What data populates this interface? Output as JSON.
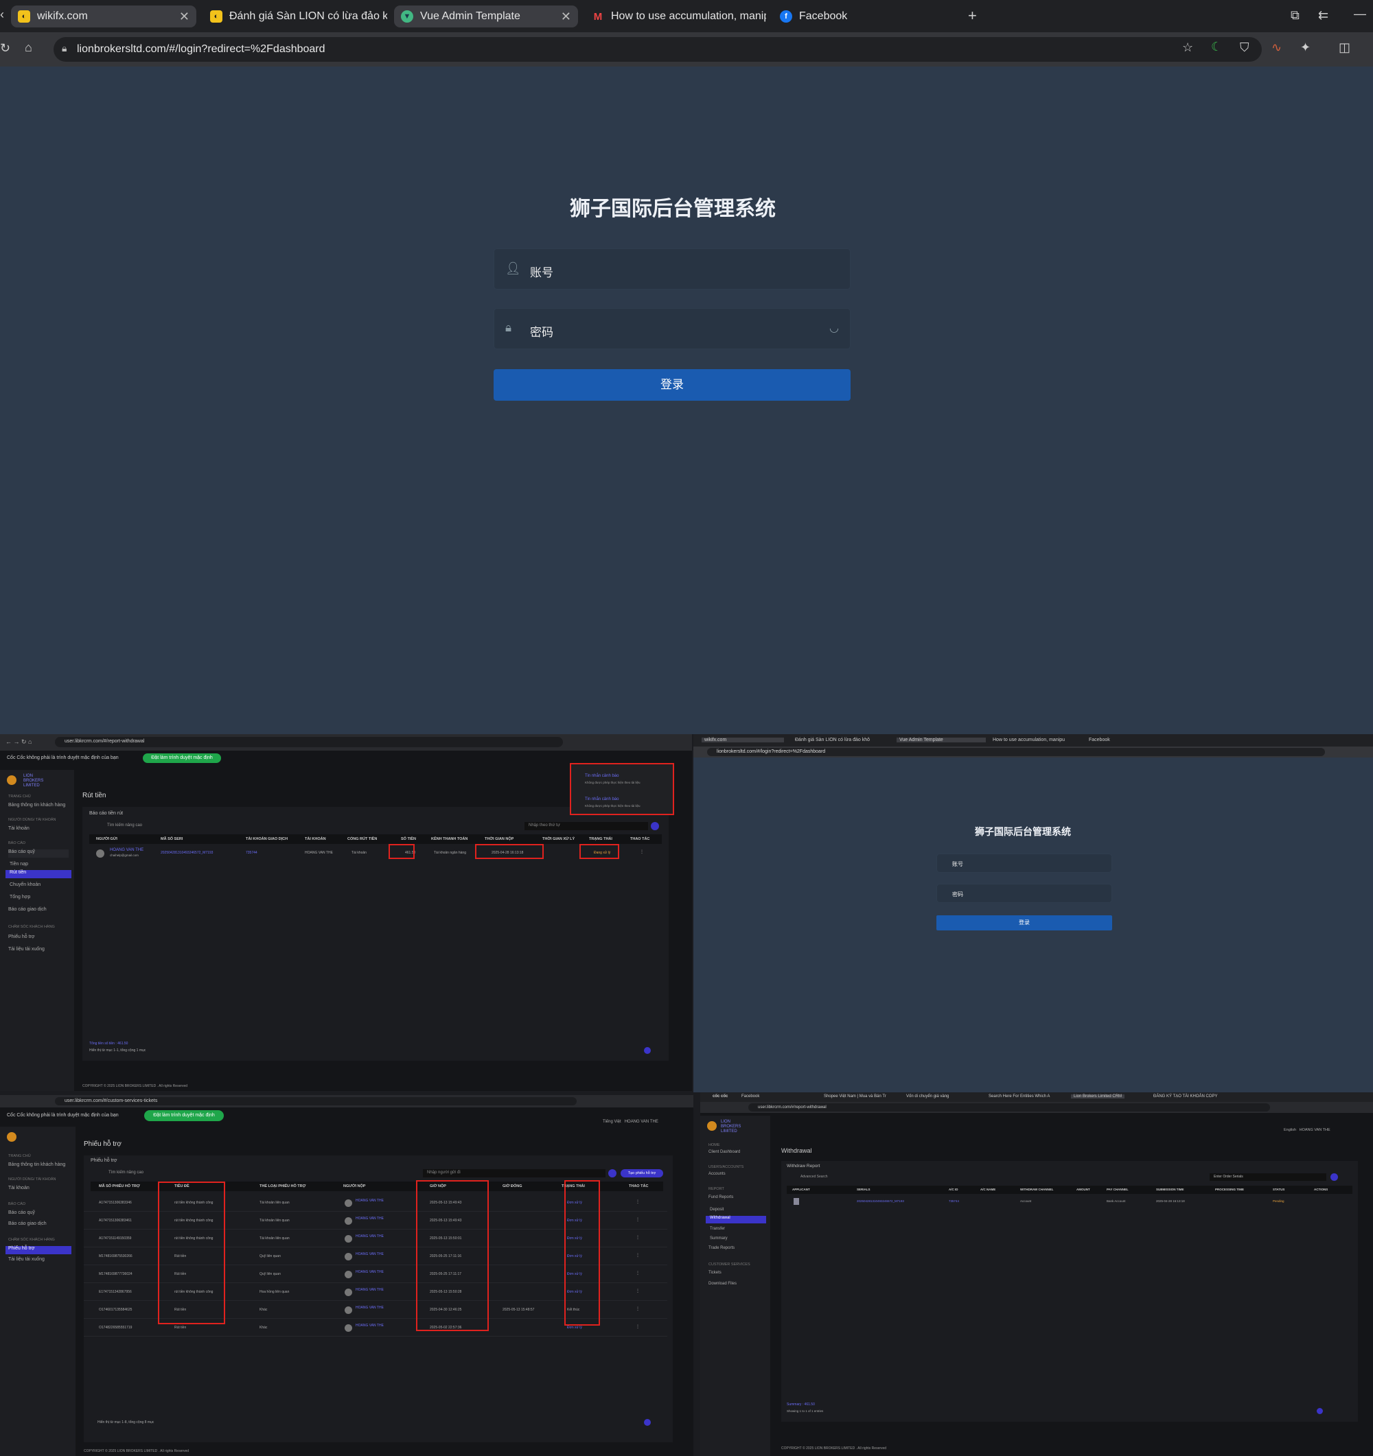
{
  "browser": {
    "tabs": [
      {
        "label": "wikifx.com",
        "active": false
      },
      {
        "label": "Đánh giá Sàn LION có lừa đảo khô",
        "active": false
      },
      {
        "label": "Vue Admin Template",
        "active": true
      },
      {
        "label": "How to use accumulation, manipu",
        "active": false
      },
      {
        "label": "Facebook",
        "active": false
      }
    ],
    "url": "lionbrokersltd.com/#/login?redirect=%2Fdashboard"
  },
  "login": {
    "title": "狮子国际后台管理系统",
    "username_placeholder": "账号",
    "password_placeholder": "密码",
    "submit_label": "登录"
  },
  "panel_withdraw": {
    "url": "user.libkrcrm.com/#/report-withdrawal",
    "notice": "Cốc Cốc không phải là trình duyệt mặc định của bạn",
    "notice_btn": "Đặt làm trình duyệt mặc định",
    "brand": "LION BROKERS LIMITED",
    "sidebar": {
      "h1": "TRANG CHỦ",
      "i1": "Bảng thông tin khách hàng",
      "h2": "NGƯỜI DÙNG/ TÀI KHOẢN",
      "i2": "Tài khoản",
      "h3": "BÁO CÁO",
      "i3": "Báo cáo quỹ",
      "i4": "Tiền nạp",
      "i5": "Rút tiền",
      "i6": "Chuyển khoản",
      "i7": "Tổng hợp",
      "i8": "Báo cáo giao dịch",
      "h4": "CHĂM SÓC KHÁCH HÀNG",
      "i9": "Phiếu hỗ trợ",
      "i10": "Tải liệu tải xuống"
    },
    "page_title": "Rút tiền",
    "section": "Báo cáo tiền rút",
    "advanced": "Tìm kiếm nâng cao",
    "search_placeholder": "Nhập theo thứ tự",
    "headers": [
      "NGƯỜI GỬI",
      "MÃ SỐ SERI",
      "TÀI KHOẢN GIAO DỊCH",
      "TÀI KHOẢN",
      "CỔNG RÚT TIỀN",
      "SỐ TIỀN",
      "KÊNH THANH TOÁN",
      "THỜI GIAN NỘP",
      "THỜI GIAN XỬ LÝ",
      "TRẠNG THÁI",
      "THAO TÁC"
    ],
    "row": {
      "name": "HOANG VAN THE",
      "email": "chaihelp@gmail.com",
      "serial": "202504281310493246572_M7193",
      "account_no": "735744",
      "holder": "HOANG VAN THE",
      "gateway": "Tài khoản",
      "amount": "461.50",
      "channel": "Tài khoản ngân hàng",
      "submitted": "2025-04-28 16:13:18",
      "status": "Đang xử lý"
    },
    "total": "Tổng tiền số tiền : 461.50",
    "showing": "Hiển thị từ mục 1-1, tổng cộng 1 mục",
    "toast_title": "Tin nhắn cảnh báo",
    "toast_body": "Không được phép thực hiện theo tài liệu",
    "footer": "COPYRIGHT © 2025 LION BROKERS LIMITED . All rights Reserved"
  },
  "panel_login_small": {
    "tabs": [
      "wikifx.com",
      "Đánh giá Sàn LION có lừa đảo khô",
      "Vue Admin Template",
      "How to use accumulation, manipu",
      "Facebook"
    ],
    "url": "lionbrokersltd.com/#/login?redirect=%2Fdashboard",
    "title": "狮子国际后台管理系统",
    "username": "账号",
    "password": "密码",
    "submit": "登录"
  },
  "panel_tickets": {
    "url": "user.libkrcrm.com/#/custom-services-tickets",
    "page_title": "Phiếu hỗ trợ",
    "section": "Phiếu hỗ trợ",
    "search_placeholder": "Nhập người gửi đi",
    "create_btn": "Tạo phiếu hỗ trợ",
    "user_lang": "Tiếng Việt",
    "user_name": "HOANG VAN THE",
    "headers": [
      "MÃ SỐ PHIẾU HỖ TRỢ",
      "TIÊU ĐỀ",
      "THỂ LOẠI PHIẾU HỖ TRỢ",
      "NGƯỜI NỘP",
      "GIỜ NỘP",
      "GIỜ ĐÓNG",
      "TRẠNG THÁI",
      "THAO TÁC"
    ],
    "rows": [
      {
        "id": "A1747151306383346",
        "title": "rút tiền không thành công",
        "type": "Tài khoản liên quan",
        "time": "2025-05-13 15:49:43",
        "close": "",
        "status": "Đơn xử lý"
      },
      {
        "id": "A1747151306383461",
        "title": "rút tiền không thành công",
        "type": "Tài khoản liên quan",
        "time": "2025-05-13 15:49:43",
        "close": "",
        "status": "Đơn xử lý"
      },
      {
        "id": "A1747151149150359",
        "title": "rút tiền không thành công",
        "type": "Tài khoản liên quan",
        "time": "2025-05-13 15:50:01",
        "close": "",
        "status": "Đơn xử lý"
      },
      {
        "id": "M1748169875530266",
        "title": "Rút tiền",
        "type": "Quỹ liên quan",
        "time": "2025-05-25 17:11:16",
        "close": "",
        "status": "Đơn xử lý"
      },
      {
        "id": "M1748169877736024",
        "title": "Rút tiền",
        "type": "Quỹ liên quan",
        "time": "2025-05-25 17:11:17",
        "close": "",
        "status": "Đơn xử lý"
      },
      {
        "id": "E1747151342867956",
        "title": "rút tiền không thành công",
        "type": "Hoa hồng liên quan",
        "time": "2025-05-13 15:50:28",
        "close": "",
        "status": "Đơn xử lý"
      },
      {
        "id": "O1746017135584625",
        "title": "Rút tiền",
        "type": "Khác",
        "time": "2025-04-30 12:46:25",
        "close": "2025-05-13 15:48:57",
        "status": "Kết thúc"
      },
      {
        "id": "O1748226585551719",
        "title": "Rút tiền",
        "type": "Khác",
        "time": "2025-05-02 22:57:36",
        "close": "",
        "status": "Đơn xử lý"
      }
    ],
    "showing": "Hiển thị từ mục 1-8, tổng cộng 8 mục",
    "footer": "COPYRIGHT © 2025 LION BROKERS LIMITED . All rights Reserved"
  },
  "panel_crm_en": {
    "tabs": [
      "cốc cốc",
      "Facebook",
      "Shopee Việt Nam | Mua và Bán Tr",
      "Vốn di chuyển giá vàng",
      "Search Here For Entities Which A",
      "Lion Brokers Limited CRM",
      "ĐĂNG KÝ TẠO TÀI KHOẢN COPY"
    ],
    "url": "user.libkrcrm.com/#/report-withdrawal",
    "lang": "English",
    "user": "HOANG VAN THE",
    "sidebar": {
      "h1": "HOME",
      "i1": "Client Dashboard",
      "h2": "USERS/ACCOUNTS",
      "i2": "Accounts",
      "h3": "REPORT",
      "i3": "Fund Reports",
      "i4": "Deposit",
      "i5": "Withdrawal",
      "i6": "Transfer",
      "i7": "Summary",
      "i8": "Trade Reports",
      "h4": "CUSTOMER SERVICES",
      "i9": "Tickets",
      "i10": "Download Files"
    },
    "page_title": "Withdrawal",
    "section": "Withdraw Report",
    "advanced": "Advanced Search",
    "search_placeholder": "Enter Order Serials",
    "headers": [
      "APPLICANT",
      "SERIALS",
      "A/C ID",
      "A/C NAME",
      "WITHDRAW CHANNEL",
      "AMOUNT",
      "PAY CHANNEL",
      "SUBMISSION TIME",
      "PROCESSING TIME",
      "STATUS",
      "ACTIONS"
    ],
    "row": {
      "serial": "202504281310493246572_M7193",
      "acid": "735744",
      "channel": "Account",
      "pay": "Bank Account",
      "time": "2025-04-28 16:13:18",
      "status": "Pending"
    },
    "summary": "Summary : 461.50",
    "showing": "Showing 1 to 1 of 1 entries",
    "footer": "COPYRIGHT © 2025 LION BROKERS LIMITED . All rights Reserved"
  },
  "colors": {
    "login_bg": "#2d3a4b",
    "button": "#1a5bb0",
    "accent": "#6a6cf5",
    "highlight": "#e0221e",
    "pending": "#e8a33c"
  }
}
